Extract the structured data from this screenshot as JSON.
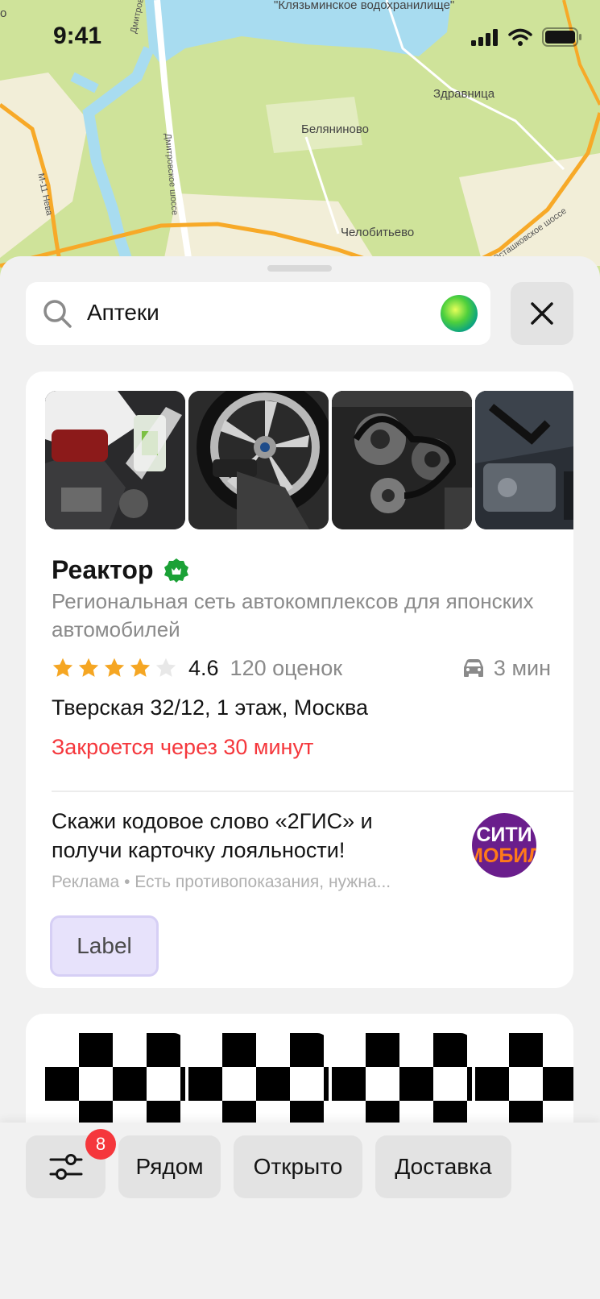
{
  "status_bar": {
    "time": "9:41"
  },
  "map": {
    "labels": {
      "reservoir": "\"Клязьминское водохранилище\"",
      "zdravnitsa": "Здравница",
      "belyaninovo": "Беляниново",
      "chelobitevo": "Челобитьево",
      "road_dmitrovskoe_1": "Дмитровское шоссе",
      "road_dmitrovskoe_2": "Дмитровское шоссе",
      "road_m11": "М-11 Нева",
      "road_ostashkovskoe": "Осташковское шоссе",
      "edge_left": "о"
    }
  },
  "search": {
    "query": "Аптеки"
  },
  "place_card": {
    "title": "Реактор",
    "description": "Региональная сеть автокомплексов для японских автомобилей",
    "rating": "4.6",
    "rating_value": 4.6,
    "reviews": "120 оценок",
    "travel_time": "3 мин",
    "address": "Тверская 32/12, 1 этаж, Москва",
    "status": "Закроется через 30 минут",
    "ad": {
      "text": "Скажи кодовое слово «2ГИС» и получи карточку лояльности!",
      "note": "Реклама • Есть противопоказания, нужна...",
      "logo_line1": "СИТИ",
      "logo_line2": "МОБИЛ",
      "button_label": "Label"
    }
  },
  "bottom_bar": {
    "filter_badge": "8",
    "chips": [
      "Рядом",
      "Открыто",
      "Доставка"
    ]
  },
  "colors": {
    "accent_red": "#f5373c",
    "verified_green": "#1ba136",
    "star_gold": "#f5a623",
    "map_green": "#cfe39a",
    "map_water": "#a8dcf0"
  }
}
